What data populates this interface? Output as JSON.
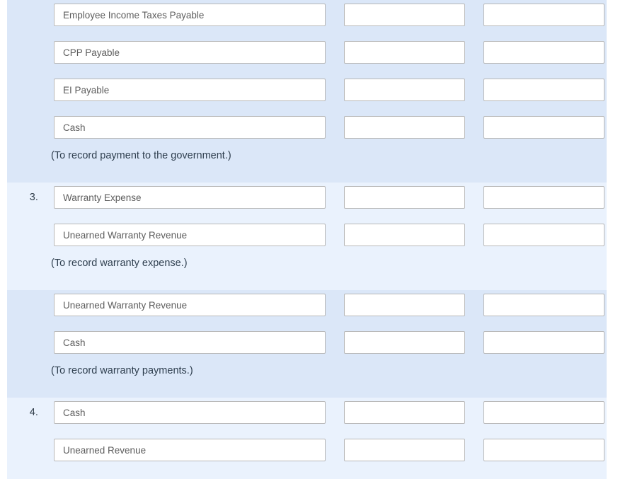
{
  "colors": {
    "band_dark": "#dbe7f8",
    "band_light": "#eaf2fd",
    "page_background": "#ffffff",
    "field_border": "#b8b8b8",
    "field_text": "#5d5d5d",
    "memo_text": "#2f3f4f",
    "number_text": "#33404d"
  },
  "blocks": [
    {
      "shade": "dark",
      "number": "",
      "rows": [
        {
          "account": "Employee Income Taxes Payable",
          "debit": "",
          "credit": ""
        },
        {
          "account": "CPP Payable",
          "debit": "",
          "credit": ""
        },
        {
          "account": "EI Payable",
          "debit": "",
          "credit": ""
        },
        {
          "account": "Cash",
          "debit": "",
          "credit": ""
        }
      ],
      "memo": "(To record payment to the government.)"
    },
    {
      "shade": "light",
      "number": "3.",
      "rows": [
        {
          "account": "Warranty Expense",
          "debit": "",
          "credit": ""
        },
        {
          "account": "Unearned Warranty Revenue",
          "debit": "",
          "credit": ""
        }
      ],
      "memo": "(To record warranty expense.)"
    },
    {
      "shade": "dark",
      "number": "",
      "rows": [
        {
          "account": "Unearned Warranty Revenue",
          "debit": "",
          "credit": ""
        },
        {
          "account": "Cash",
          "debit": "",
          "credit": ""
        }
      ],
      "memo": "(To record warranty payments.)"
    },
    {
      "shade": "light",
      "number": "4.",
      "rows": [
        {
          "account": "Cash",
          "debit": "",
          "credit": ""
        },
        {
          "account": "Unearned Revenue",
          "debit": "",
          "credit": ""
        }
      ],
      "memo": ""
    }
  ]
}
